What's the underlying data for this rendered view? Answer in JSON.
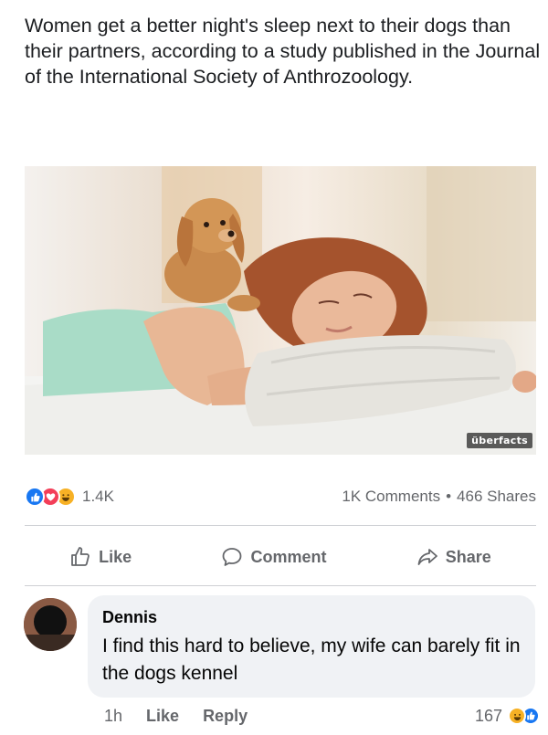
{
  "post": {
    "text": "Women get a better night's sleep next to their dogs than their partners, according to a study published in the Journal of the International Society of Anthrozoology.",
    "image_watermark": "überfacts"
  },
  "stats": {
    "reaction_count": "1.4K",
    "comments": "1K Comments",
    "separator": "•",
    "shares": "466 Shares",
    "reaction_icons": [
      "like-icon",
      "love-icon",
      "haha-icon"
    ]
  },
  "actions": {
    "like_label": "Like",
    "comment_label": "Comment",
    "share_label": "Share"
  },
  "comment": {
    "author": "Dennis",
    "text": "I find this hard to believe, my wife can barely fit in the dogs kennel",
    "time": "1h",
    "like_label": "Like",
    "reply_label": "Reply",
    "reaction_count": "167",
    "reaction_icons": [
      "haha-icon",
      "like-icon"
    ]
  },
  "colors": {
    "facebook_blue": "#1877f2",
    "love_red": "#f33e58",
    "haha_yellow": "#f7b125",
    "secondary_text": "#65676b",
    "bubble_bg": "#f0f2f5"
  }
}
